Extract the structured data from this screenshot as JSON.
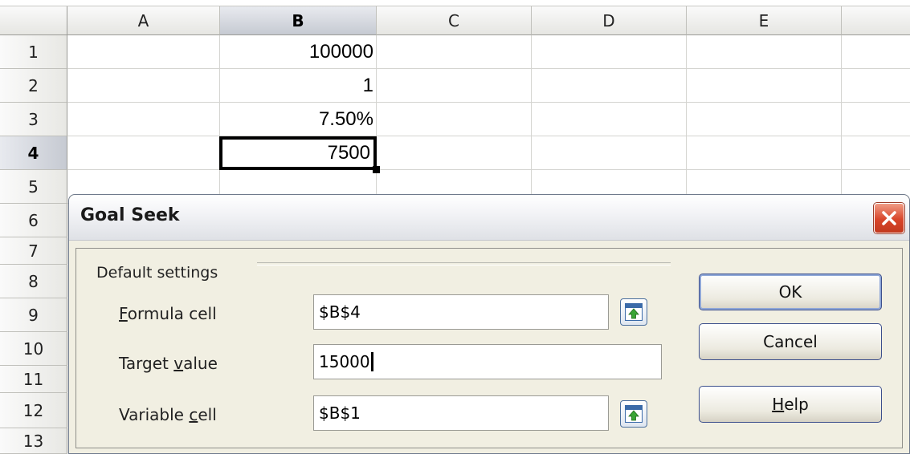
{
  "columns": [
    "A",
    "B",
    "C",
    "D",
    "E"
  ],
  "rows": [
    "1",
    "2",
    "3",
    "4",
    "5",
    "6",
    "7",
    "8",
    "9",
    "10",
    "11",
    "12",
    "13"
  ],
  "selection": {
    "column": "B",
    "row": "4"
  },
  "cells": {
    "B1": "100000",
    "B2": "1",
    "B3": "7.50%",
    "B4": "7500"
  },
  "dialog": {
    "title": "Goal Seek",
    "group_label": "Default settings",
    "formula_cell": {
      "label_accel": "F",
      "label_rest": "ormula cell",
      "value": "$B$4"
    },
    "target_value": {
      "label_pre": "Target ",
      "label_accel": "v",
      "label_rest": "alue",
      "value": "15000"
    },
    "variable_cell": {
      "label_pre": "Variable ",
      "label_accel": "c",
      "label_rest": "ell",
      "value": "$B$1"
    },
    "buttons": {
      "ok": "OK",
      "cancel": "Cancel",
      "help_accel": "H",
      "help_rest": "elp"
    },
    "icons": {
      "close": "close-icon",
      "shrink": "shrink-icon"
    },
    "colors": {
      "close_button": "#d8452a",
      "dialog_bg": "#f1efe2",
      "button_border": "#3c4f8c"
    }
  }
}
